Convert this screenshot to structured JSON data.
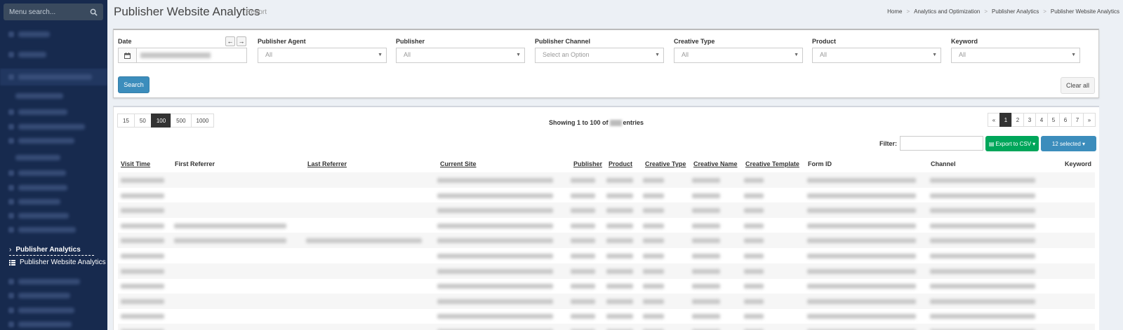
{
  "sidebar": {
    "search_placeholder": "Menu search...",
    "active_group": "Publisher Analytics",
    "active_item": "Publisher Website Analytics"
  },
  "header": {
    "title": "Publisher Website Analytics",
    "subtitle": "Report",
    "breadcrumb": [
      "Home",
      "Analytics and Optimization",
      "Publisher Analytics",
      "Publisher Website Analytics"
    ],
    "breadcrumb_sep": ">"
  },
  "filters": {
    "date_label": "Date",
    "publisher_agent": {
      "label": "Publisher Agent",
      "value": "All"
    },
    "publisher": {
      "label": "Publisher",
      "value": "All"
    },
    "publisher_channel": {
      "label": "Publisher Channel",
      "value": "Select an Option"
    },
    "creative_type": {
      "label": "Creative Type",
      "value": "All"
    },
    "product": {
      "label": "Product",
      "value": "All"
    },
    "keyword": {
      "label": "Keyword",
      "value": "All"
    },
    "search_button": "Search",
    "clear_button": "Clear all"
  },
  "table": {
    "page_sizes": [
      "15",
      "50",
      "100",
      "500",
      "1000"
    ],
    "active_page_size": "100",
    "showing_prefix": "Showing 1 to 100 of",
    "showing_suffix": "entries",
    "pages": [
      "«",
      "1",
      "2",
      "3",
      "4",
      "5",
      "6",
      "7",
      "»"
    ],
    "active_page": "1",
    "filter_label": "Filter:",
    "export_button": "Export to CSV",
    "selected_button": "12 selected",
    "columns": [
      "Visit Time",
      "First Referrer",
      "Last Referrer",
      "Current Site",
      "Publisher",
      "Product",
      "Creative Type",
      "Creative Name",
      "Creative Template",
      "Form ID",
      "Channel",
      "Keyword"
    ]
  },
  "colors": {
    "sidebar_bg": "#172a4e",
    "primary": "#3c8dbc",
    "success": "#00a65a",
    "active_page": "#333333"
  }
}
